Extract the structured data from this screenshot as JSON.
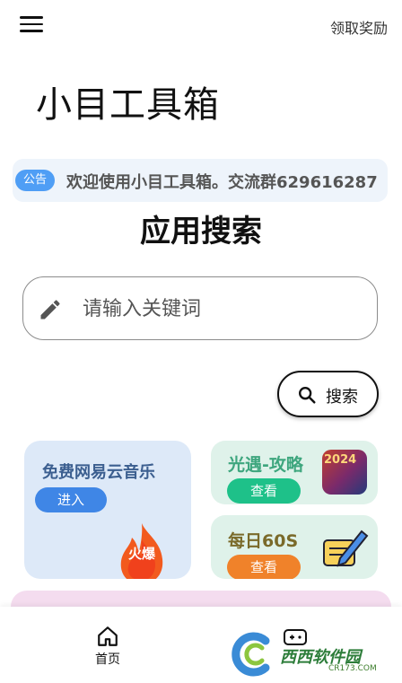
{
  "header": {
    "reward_label": "领取奖励"
  },
  "app_title": "小目工具箱",
  "notice": {
    "badge": "公告",
    "text": "欢迎使用小目工具箱。交流群629616287"
  },
  "section_title": "应用搜索",
  "search": {
    "placeholder": "请输入关键词",
    "button_label": "搜索"
  },
  "cards": {
    "music": {
      "title": "免费网易云音乐",
      "button": "进入",
      "badge": "火爆"
    },
    "guide": {
      "title": "光遇-攻略",
      "button": "查看",
      "thumb_text": "2024"
    },
    "daily": {
      "title": "每日60S",
      "button": "查看"
    }
  },
  "bottom_nav": {
    "home_label": "首页"
  },
  "watermark": {
    "logo_text": "西西软件园",
    "sub_text": "CR173.COM"
  },
  "colors": {
    "accent_blue": "#3f86e6",
    "accent_green": "#1ec189",
    "accent_orange": "#f0822a"
  }
}
